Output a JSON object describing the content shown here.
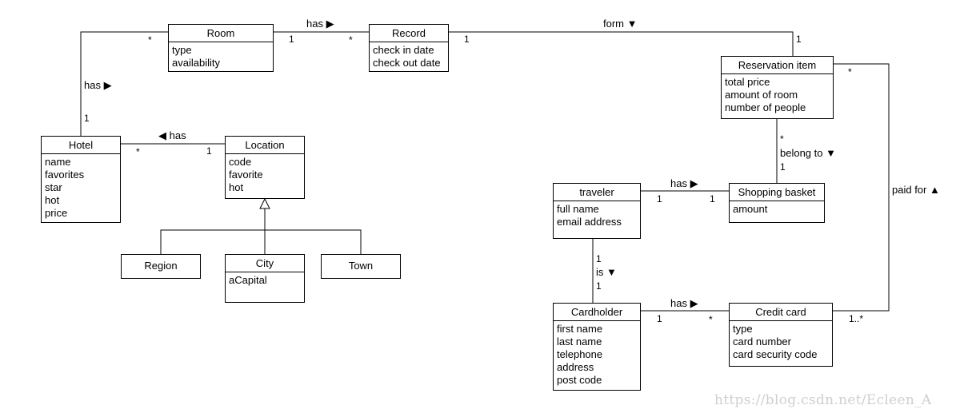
{
  "diagram": {
    "type": "UML class diagram",
    "classes": {
      "room": {
        "name": "Room",
        "attributes": [
          "type",
          "availability"
        ]
      },
      "record": {
        "name": "Record",
        "attributes": [
          "check in date",
          "check out date"
        ]
      },
      "hotel": {
        "name": "Hotel",
        "attributes": [
          "name",
          "favorites",
          "star",
          "hot",
          "price"
        ]
      },
      "location": {
        "name": "Location",
        "attributes": [
          "code",
          "favorite",
          "hot"
        ]
      },
      "region": {
        "name": "Region",
        "attributes": []
      },
      "city": {
        "name": "City",
        "attributes": [
          "aCapital"
        ]
      },
      "town": {
        "name": "Town",
        "attributes": []
      },
      "reservation_item": {
        "name": "Reservation item",
        "attributes": [
          "total price",
          "amount of room",
          "number of people"
        ]
      },
      "traveler": {
        "name": "traveler",
        "attributes": [
          "full name",
          "email address"
        ]
      },
      "shopping_basket": {
        "name": "Shopping basket",
        "attributes": [
          "amount"
        ]
      },
      "cardholder": {
        "name": "Cardholder",
        "attributes": [
          "first name",
          "last name",
          "telephone",
          "address",
          "post code"
        ]
      },
      "credit_card": {
        "name": "Credit card",
        "attributes": [
          "type",
          "card number",
          "card security code"
        ]
      }
    },
    "associations": {
      "hotel_room": {
        "label": "has ▶",
        "from": "Hotel",
        "to": "Room",
        "from_mult": "1",
        "to_mult": "*"
      },
      "room_record": {
        "label": "has ▶",
        "from": "Room",
        "to": "Record",
        "from_mult": "1",
        "to_mult": "*"
      },
      "record_reservation": {
        "label": "form ▼",
        "from": "Record",
        "to": "Reservation item",
        "from_mult": "1",
        "to_mult": "1"
      },
      "hotel_location": {
        "label": "◀ has",
        "from": "Hotel",
        "to": "Location",
        "from_mult": "*",
        "to_mult": "1"
      },
      "reservation_basket": {
        "label": "belong to ▼",
        "from": "Reservation item",
        "to": "Shopping basket",
        "from_mult": "*",
        "to_mult": "1"
      },
      "traveler_basket": {
        "label": "has ▶",
        "from": "traveler",
        "to": "Shopping basket",
        "from_mult": "1",
        "to_mult": "1"
      },
      "traveler_cardholder": {
        "label": "is ▼",
        "from": "traveler",
        "to": "Cardholder",
        "from_mult": "1",
        "to_mult": "1"
      },
      "cardholder_creditcard": {
        "label": "has ▶",
        "from": "Cardholder",
        "to": "Credit card",
        "from_mult": "1",
        "to_mult": "*"
      },
      "creditcard_reservation": {
        "label": "paid for ▲",
        "from": "Credit card",
        "to": "Reservation item",
        "from_mult": "1..*",
        "to_mult": "*"
      }
    },
    "generalizations": [
      {
        "parent": "Location",
        "children": [
          "Region",
          "City",
          "Town"
        ]
      }
    ]
  },
  "watermark": "https://blog.csdn.net/Ecleen_A"
}
